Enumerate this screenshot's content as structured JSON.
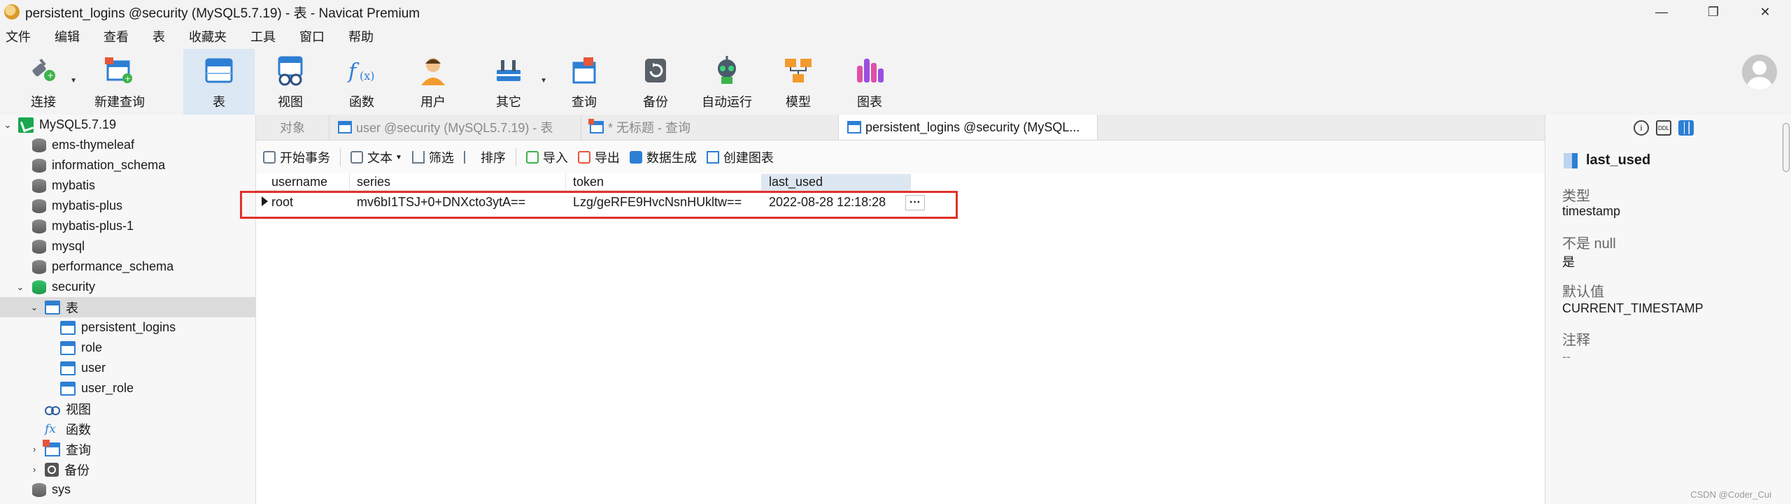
{
  "window": {
    "title": "persistent_logins @security (MySQL5.7.19) - 表 - Navicat Premium",
    "controls": [
      "—",
      "❐",
      "✕"
    ]
  },
  "menu": [
    "文件",
    "编辑",
    "查看",
    "表",
    "收藏夹",
    "工具",
    "窗口",
    "帮助"
  ],
  "toolbar": {
    "connect": "连接",
    "new_query": "新建查询",
    "table": "表",
    "view": "视图",
    "function": "函数",
    "user": "用户",
    "other": "其它",
    "query": "查询",
    "backup": "备份",
    "automation": "自动运行",
    "model": "模型",
    "chart": "图表"
  },
  "nav": {
    "connection": "MySQL5.7.19",
    "databases": [
      "ems-thymeleaf",
      "information_schema",
      "mybatis",
      "mybatis-plus",
      "mybatis-plus-1",
      "mysql",
      "performance_schema",
      "security",
      "sys"
    ],
    "tables_group": "表",
    "tables": [
      "persistent_logins",
      "role",
      "user",
      "user_role"
    ],
    "views": "视图",
    "functions": "函数",
    "queries": "查询",
    "backups": "备份"
  },
  "tabs": {
    "objects": "对象",
    "tab2": "user @security (MySQL5.7.19) - 表",
    "tab3": "* 无标题 - 查询",
    "tab4": "persistent_logins @security (MySQL..."
  },
  "data_toolbar": {
    "begin_tx": "开始事务",
    "text": "文本",
    "filter": "筛选",
    "sort": "排序",
    "import": "导入",
    "export": "导出",
    "data_gen": "数据生成",
    "create_chart": "创建图表"
  },
  "grid": {
    "columns": [
      "username",
      "series",
      "token",
      "last_used"
    ],
    "rows": [
      [
        "root",
        "mv6bI1TSJ+0+DNXcto3ytA==",
        "Lzg/geRFE9HvcNsnHUkltw==",
        "2022-08-28 12:18:28"
      ]
    ],
    "ellipsis": "···"
  },
  "info": {
    "field_name": "last_used",
    "type_label": "类型",
    "type_value": "timestamp",
    "notnull_label": "不是 null",
    "notnull_value": "是",
    "default_label": "默认值",
    "default_value": "CURRENT_TIMESTAMP",
    "comment_label": "注释",
    "comment_value": "--",
    "icons": [
      "i",
      "DDL"
    ]
  },
  "watermark": "CSDN @Coder_Cui"
}
